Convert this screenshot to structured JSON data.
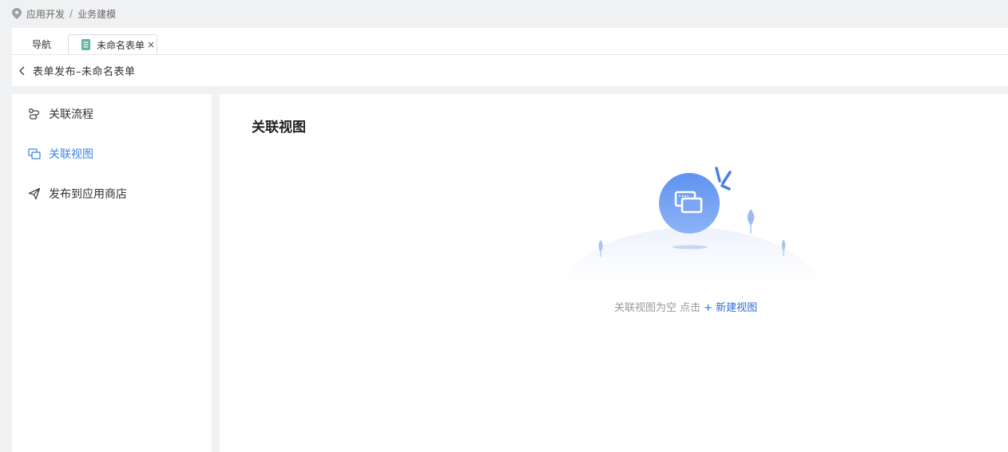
{
  "breadcrumb": {
    "icon": "location-pin-icon",
    "items": [
      "应用开发",
      "业务建模"
    ],
    "separator": "/"
  },
  "tabs": {
    "nav_label": "导航",
    "open_tab": {
      "label": "未命名表单",
      "icon": "document-icon",
      "close_glyph": "×"
    }
  },
  "page": {
    "back_icon": "chevron-left-icon",
    "title": "表单发布–未命名表单"
  },
  "sidebar": {
    "items": [
      {
        "label": "关联流程",
        "icon": "flow-link-icon",
        "active": false
      },
      {
        "label": "关联视图",
        "icon": "view-link-icon",
        "active": true
      },
      {
        "label": "发布到应用商店",
        "icon": "paper-plane-icon",
        "active": false
      }
    ]
  },
  "main": {
    "title": "关联视图",
    "empty_state": {
      "icon": "view-link-icon",
      "message": "关联视图为空 点击",
      "action_label": "+ 新建视图"
    }
  },
  "colors": {
    "accent": "#3b87e4",
    "link": "#2f6fd6",
    "background": "#f0f1f3",
    "panel": "#ffffff"
  }
}
